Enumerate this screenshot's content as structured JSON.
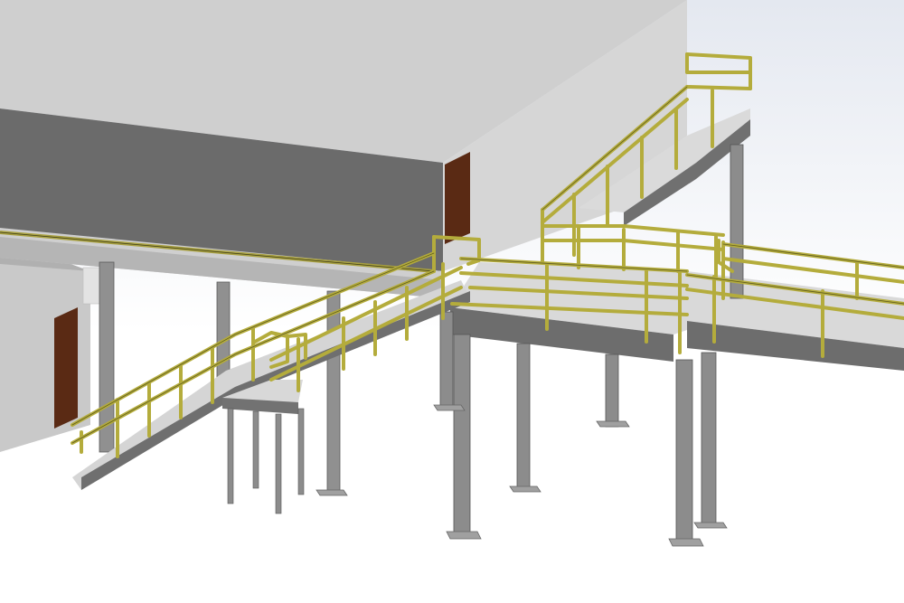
{
  "scene": {
    "description_visible_text": "",
    "colors": {
      "background_top": "#e4e8f0",
      "background_bottom": "#ffffff",
      "wall_front": "#6a6a6a",
      "wall_side": "#d8d8d8",
      "roof": "#cfcfcf",
      "lower_wall": "#c8c8c8",
      "door": "#5a2a14",
      "deck_top": "#dcdcdc",
      "deck_edge": "#6f6f6f",
      "column": "#8a8a8a",
      "column_dark": "#5e5e5e",
      "handrail": "#b8b040",
      "handrail_dark": "#4a4a18",
      "base_plate": "#9a9a9a"
    }
  }
}
